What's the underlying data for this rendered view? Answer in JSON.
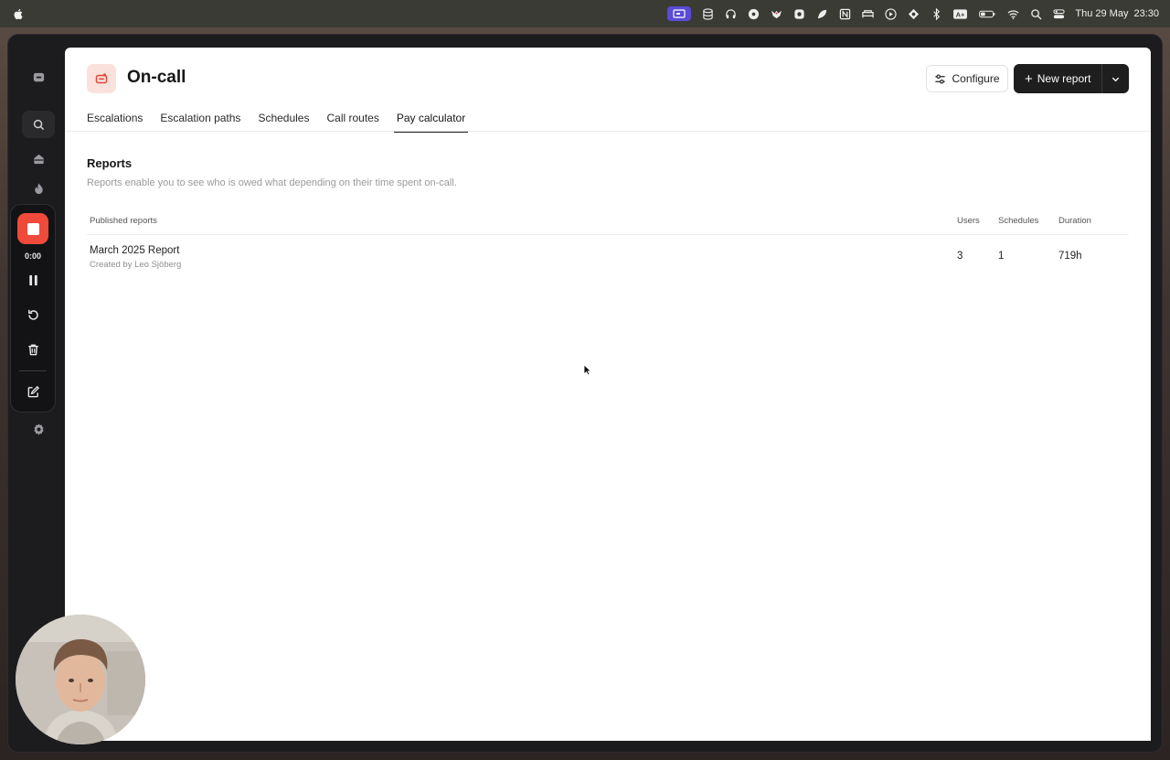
{
  "menubar": {
    "date": "Thu 29 May",
    "time": "23:30",
    "icons": [
      "screen-record-icon",
      "database-icon",
      "headphones-icon",
      "disc-icon",
      "bird-icon",
      "plugin-icon",
      "arc-icon",
      "notion-icon",
      "bed-icon",
      "play-icon",
      "vpn-icon",
      "bluetooth-icon",
      "keyboard-input-icon",
      "battery-icon",
      "wifi-icon",
      "spotlight-search-icon",
      "control-center-icon"
    ],
    "input_label": "A"
  },
  "recorder": {
    "elapsed": "0:00"
  },
  "page": {
    "title": "On-call",
    "configure_label": "Configure",
    "new_report_label": "New report"
  },
  "tabs": [
    {
      "label": "Escalations",
      "active": false
    },
    {
      "label": "Escalation paths",
      "active": false
    },
    {
      "label": "Schedules",
      "active": false
    },
    {
      "label": "Call routes",
      "active": false
    },
    {
      "label": "Pay calculator",
      "active": true
    }
  ],
  "reports": {
    "title": "Reports",
    "description": "Reports enable you to see who is owed what depending on their time spent on-call.",
    "columns": {
      "published": "Published reports",
      "users": "Users",
      "schedules": "Schedules",
      "duration": "Duration"
    },
    "rows": [
      {
        "name": "March 2025 Report",
        "created_by": "Created by Leo Sjöberg",
        "users": "3",
        "schedules": "1",
        "duration": "719h"
      }
    ]
  },
  "colors": {
    "accent_red": "#ef4a3a",
    "primary_button": "#1e1e1e",
    "record_badge": "#5b4bd6"
  }
}
